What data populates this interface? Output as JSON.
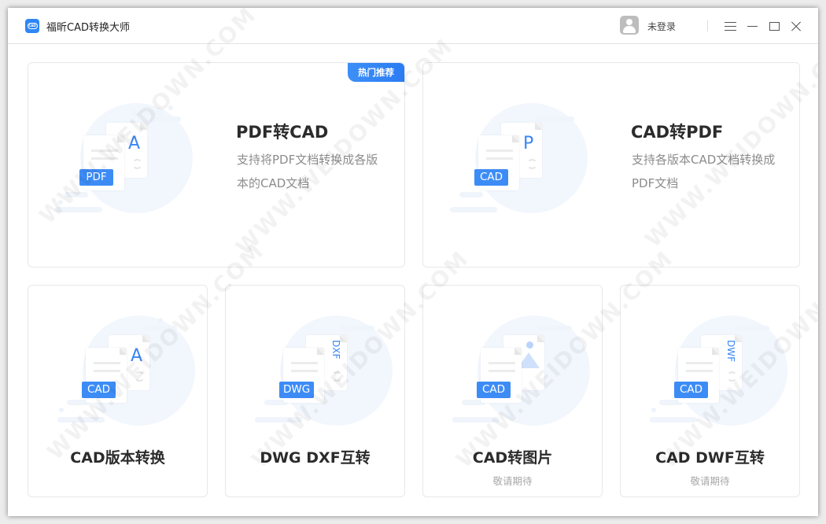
{
  "window": {
    "app_title": "福昕CAD转换大师",
    "logo_icon": "cad-logo-icon",
    "user": {
      "status": "未登录",
      "avatar_icon": "user-avatar-icon"
    },
    "controls": [
      {
        "name": "menu",
        "icon": "hamburger-menu-icon"
      },
      {
        "name": "minimize",
        "icon": "minimize-icon"
      },
      {
        "name": "maximize",
        "icon": "maximize-icon"
      },
      {
        "name": "close",
        "icon": "close-icon"
      }
    ]
  },
  "featured": [
    {
      "title": "PDF转CAD",
      "description": "支持将PDF文档转换成各版本的CAD文档",
      "badge": "热门推荐",
      "source_tag": "PDF",
      "target_glyph": "A",
      "icon": "pdf-to-cad-icon"
    },
    {
      "title": "CAD转PDF",
      "description": "支持各版本CAD文档转换成PDF文档",
      "source_tag": "CAD",
      "target_glyph": "P",
      "icon": "cad-to-pdf-icon"
    }
  ],
  "tools": [
    {
      "title": "CAD版本转换",
      "subtitle": "",
      "source_tag": "CAD",
      "target_glyph": "A",
      "icon": "cad-version-convert-icon"
    },
    {
      "title": "DWG DXF互转",
      "subtitle": "",
      "source_tag": "DWG",
      "target_glyph": "DXF",
      "icon": "dwg-dxf-convert-icon"
    },
    {
      "title": "CAD转图片",
      "subtitle": "敬请期待",
      "source_tag": "CAD",
      "target_glyph": "",
      "icon": "cad-to-image-icon"
    },
    {
      "title": "CAD DWF互转",
      "subtitle": "敬请期待",
      "source_tag": "CAD",
      "target_glyph": "DWF",
      "icon": "cad-dwf-convert-icon"
    }
  ],
  "watermark": "WWW.WEIDOWN.COM",
  "colors": {
    "accent": "#3d8cf6",
    "title_text": "#2b2b2b",
    "desc_text": "#8c8c8c",
    "coming_soon": "#a8a8a8"
  }
}
